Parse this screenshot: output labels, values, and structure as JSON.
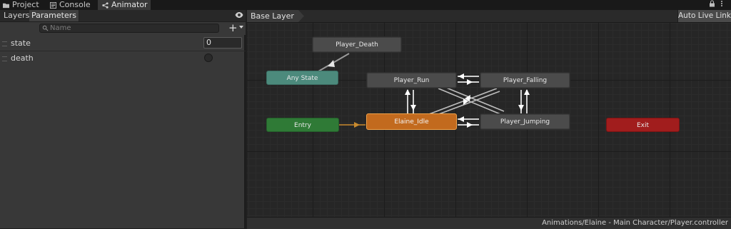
{
  "tabs": [
    {
      "label": "Project",
      "icon": "folder-icon",
      "active": false
    },
    {
      "label": "Console",
      "icon": "console-icon",
      "active": false
    },
    {
      "label": "Animator",
      "icon": "animator-icon",
      "active": true
    }
  ],
  "left_panel": {
    "tabs": [
      {
        "label": "Layers",
        "active": false
      },
      {
        "label": "Parameters",
        "active": true
      }
    ],
    "search_placeholder": "Name",
    "add_label": "+",
    "parameters": [
      {
        "name": "state",
        "type": "int",
        "value": "0"
      },
      {
        "name": "death",
        "type": "bool",
        "value": false
      }
    ]
  },
  "graph": {
    "breadcrumb": "Base Layer",
    "auto_live_link": "Auto Live Link",
    "states": {
      "player_death": "Player_Death",
      "any_state": "Any State",
      "player_run": "Player_Run",
      "player_falling": "Player_Falling",
      "entry": "Entry",
      "elaine_idle": "Elaine_Idle",
      "player_jumping": "Player_Jumping",
      "exit": "Exit"
    },
    "default_state": "Elaine_Idle"
  },
  "status": {
    "path": "Animations/Elaine - Main Character/Player.controller"
  },
  "colors": {
    "default_state": "#c26a1e",
    "entry": "#2f7a36",
    "any_state": "#4c8a7c",
    "exit": "#a11d1d",
    "state": "#4b4b4b",
    "default_transition": "#c88a2e"
  }
}
